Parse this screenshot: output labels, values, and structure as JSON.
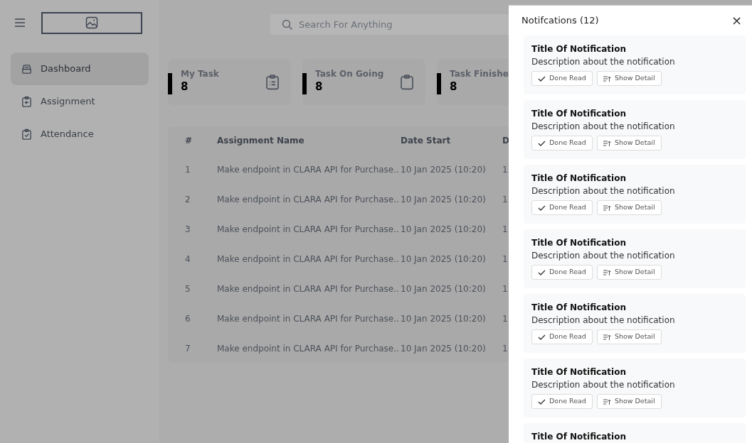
{
  "sidebar": {
    "items": [
      {
        "label": "Dashboard",
        "selected": true
      },
      {
        "label": "Assignment",
        "selected": false
      },
      {
        "label": "Attendance",
        "selected": false
      }
    ]
  },
  "search": {
    "placeholder": "Search For Anything"
  },
  "stats": [
    {
      "label": "My Task",
      "value": "8"
    },
    {
      "label": "Task On Going",
      "value": "8"
    },
    {
      "label": "Task Finishe",
      "value": "8"
    }
  ],
  "table": {
    "columns": [
      "#",
      "Assignment Name",
      "Date Start",
      "D"
    ],
    "rows": [
      [
        "1",
        "Make endpoint in CLARA API for Purchase..",
        "10 Jan 2025 (10:20)",
        "1"
      ],
      [
        "2",
        "Make endpoint in CLARA API for Purchase..",
        "10 Jan 2025 (10:20)",
        "1"
      ],
      [
        "3",
        "Make endpoint in CLARA API for Purchase..",
        "10 Jan 2025 (10:20)",
        "1"
      ],
      [
        "4",
        "Make endpoint in CLARA API for Purchase..",
        "10 Jan 2025 (10:20)",
        "1"
      ],
      [
        "5",
        "Make endpoint in CLARA API for Purchase..",
        "10 Jan 2025 (10:20)",
        "1"
      ],
      [
        "6",
        "Make endpoint in CLARA API for Purchase..",
        "10 Jan 2025 (10:20)",
        "1"
      ],
      [
        "7",
        "Make endpoint in CLARA API for Purchase..",
        "10 Jan 2025 (10:20)",
        "1"
      ]
    ]
  },
  "notifications": {
    "title": "Notifcations (12)",
    "close": "×",
    "items": [
      {
        "title": "Title Of Notification",
        "description": "Description about the notification",
        "actions": [
          "Done Read",
          "Show Detail"
        ]
      },
      {
        "title": "Title Of Notification",
        "description": "Description about the notification",
        "actions": [
          "Done Read",
          "Show Detail"
        ]
      },
      {
        "title": "Title Of Notification",
        "description": "Description about the notification",
        "actions": [
          "Done Read",
          "Show Detail"
        ]
      },
      {
        "title": "Title Of Notification",
        "description": "Description about the notification",
        "actions": [
          "Done Read",
          "Show Detail"
        ]
      },
      {
        "title": "Title Of Notification",
        "description": "Description about the notification",
        "actions": [
          "Done Read",
          "Show Detail"
        ]
      },
      {
        "title": "Title Of Notification",
        "description": "Description about the notification",
        "actions": [
          "Done Read",
          "Show Detail"
        ]
      },
      {
        "title": "Title Of Notification"
      }
    ]
  }
}
